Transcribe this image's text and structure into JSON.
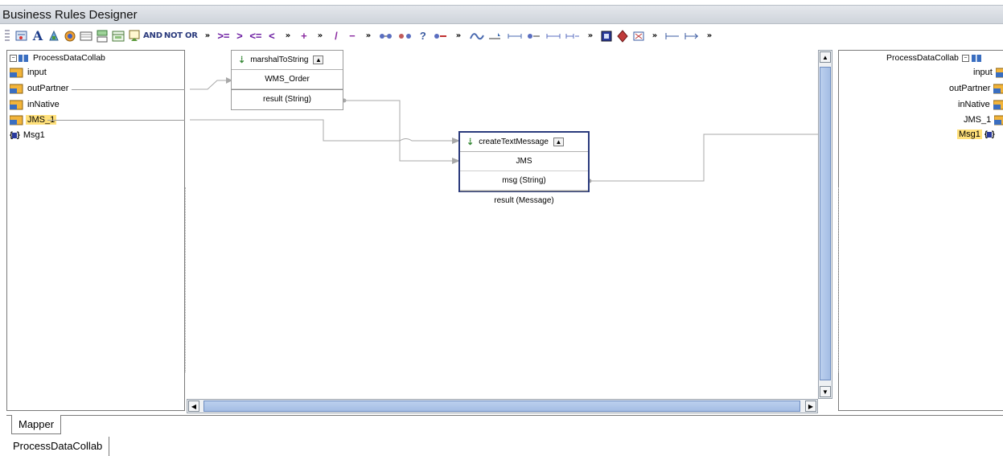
{
  "window": {
    "title": "Business Rules Designer"
  },
  "toolbar": {
    "operators": [
      "AND",
      "NOT",
      "OR",
      "»",
      ">=",
      ">",
      "<=",
      "<",
      "»",
      "+",
      "»",
      "/",
      "−",
      "»"
    ],
    "more": "»"
  },
  "left_tree": {
    "root": "ProcessDataCollab",
    "items": [
      {
        "label": "input",
        "icon": "folder-icon"
      },
      {
        "label": "outPartner",
        "icon": "folder-icon"
      },
      {
        "label": "inNative",
        "icon": "folder-icon"
      },
      {
        "label": "JMS_1",
        "icon": "folder-icon",
        "selected": true
      },
      {
        "label": "Msg1",
        "icon": "message-icon"
      }
    ]
  },
  "right_tree": {
    "root": "ProcessDataCollab",
    "items": [
      {
        "label": "input",
        "icon": "folder-icon"
      },
      {
        "label": "outPartner",
        "icon": "folder-icon"
      },
      {
        "label": "inNative",
        "icon": "folder-icon"
      },
      {
        "label": "JMS_1",
        "icon": "folder-icon"
      },
      {
        "label": "Msg1",
        "icon": "message-icon",
        "selected": true
      }
    ]
  },
  "methods": {
    "marshal": {
      "name": "marshalToString",
      "param": "WMS_Order",
      "result": "result (String)"
    },
    "create": {
      "name": "createTextMessage",
      "params": [
        "JMS",
        "msg (String)"
      ],
      "result": "result (Message)"
    }
  },
  "tabs": {
    "mapper": "Mapper",
    "collab": "ProcessDataCollab"
  },
  "colors": {
    "selection": "#ffe07a",
    "active_border": "#2a3a7c",
    "scroll_thumb": "#a4bde4"
  }
}
